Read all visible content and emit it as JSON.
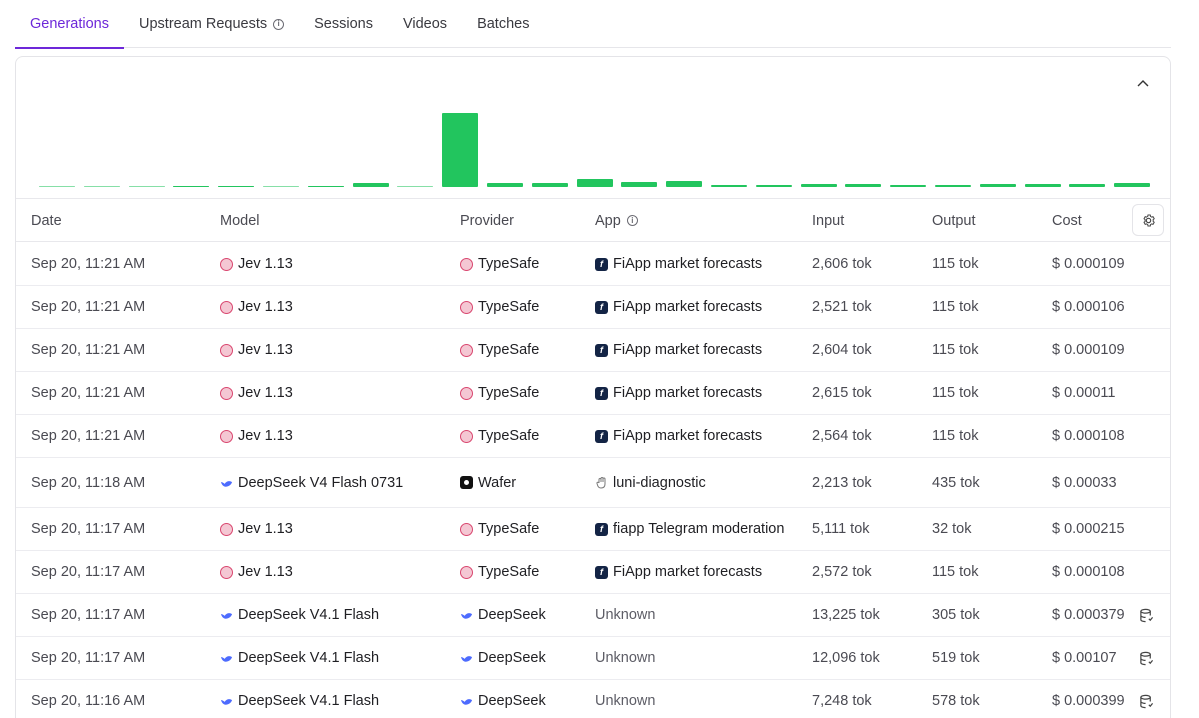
{
  "tabs": [
    {
      "label": "Generations",
      "active": true
    },
    {
      "label": "Upstream Requests",
      "info": true
    },
    {
      "label": "Sessions"
    },
    {
      "label": "Videos"
    },
    {
      "label": "Batches"
    }
  ],
  "chart_data": {
    "type": "bar",
    "color": "#22c55e",
    "values": [
      1,
      1,
      1,
      2,
      2,
      0,
      2,
      5,
      1,
      100,
      5,
      5,
      11,
      7,
      8,
      3,
      3,
      4,
      4,
      3,
      3,
      4,
      4,
      4,
      6
    ]
  },
  "table": {
    "headers": {
      "date": "Date",
      "model": "Model",
      "provider": "Provider",
      "app": "App",
      "input": "Input",
      "output": "Output",
      "cost": "Cost"
    },
    "rows": [
      {
        "date": "Sep 20, 11:21 AM",
        "model": "Jev 1.13",
        "model_icon": "typesafe-icon",
        "provider": "TypeSafe",
        "provider_icon": "typesafe-icon",
        "app": "FiApp market forecasts",
        "app_icon": "fiapp-icon",
        "input": "2,606 tok",
        "output": "115 tok",
        "cost": "$ 0.000109"
      },
      {
        "date": "Sep 20, 11:21 AM",
        "model": "Jev 1.13",
        "model_icon": "typesafe-icon",
        "provider": "TypeSafe",
        "provider_icon": "typesafe-icon",
        "app": "FiApp market forecasts",
        "app_icon": "fiapp-icon",
        "input": "2,521 tok",
        "output": "115 tok",
        "cost": "$ 0.000106"
      },
      {
        "date": "Sep 20, 11:21 AM",
        "model": "Jev 1.13",
        "model_icon": "typesafe-icon",
        "provider": "TypeSafe",
        "provider_icon": "typesafe-icon",
        "app": "FiApp market forecasts",
        "app_icon": "fiapp-icon",
        "input": "2,604 tok",
        "output": "115 tok",
        "cost": "$ 0.000109"
      },
      {
        "date": "Sep 20, 11:21 AM",
        "model": "Jev 1.13",
        "model_icon": "typesafe-icon",
        "provider": "TypeSafe",
        "provider_icon": "typesafe-icon",
        "app": "FiApp market forecasts",
        "app_icon": "fiapp-icon",
        "input": "2,615 tok",
        "output": "115 tok",
        "cost": "$ 0.00011"
      },
      {
        "date": "Sep 20, 11:21 AM",
        "model": "Jev 1.13",
        "model_icon": "typesafe-icon",
        "provider": "TypeSafe",
        "provider_icon": "typesafe-icon",
        "app": "FiApp market forecasts",
        "app_icon": "fiapp-icon",
        "input": "2,564 tok",
        "output": "115 tok",
        "cost": "$ 0.000108"
      },
      {
        "date": "Sep 20, 11:18 AM",
        "model": "DeepSeek V4 Flash 0731",
        "model_icon": "deepseek-icon",
        "provider": "Wafer",
        "provider_icon": "wafer-icon",
        "app": "luni-diagnostic",
        "app_icon": "hand-icon",
        "input": "2,213 tok",
        "output": "435 tok",
        "cost": "$ 0.00033"
      },
      {
        "date": "Sep 20, 11:17 AM",
        "model": "Jev 1.13",
        "model_icon": "typesafe-icon",
        "provider": "TypeSafe",
        "provider_icon": "typesafe-icon",
        "app": "fiapp Telegram moderation",
        "app_icon": "fiapp-icon",
        "input": "5,111 tok",
        "output": "32 tok",
        "cost": "$ 0.000215"
      },
      {
        "date": "Sep 20, 11:17 AM",
        "model": "Jev 1.13",
        "model_icon": "typesafe-icon",
        "provider": "TypeSafe",
        "provider_icon": "typesafe-icon",
        "app": "FiApp market forecasts",
        "app_icon": "fiapp-icon",
        "input": "2,572 tok",
        "output": "115 tok",
        "cost": "$ 0.000108"
      },
      {
        "date": "Sep 20, 11:17 AM",
        "model": "DeepSeek V4.1 Flash",
        "model_icon": "deepseek-icon",
        "provider": "DeepSeek",
        "provider_icon": "deepseek-icon",
        "app": "Unknown",
        "app_icon": "",
        "input": "13,225 tok",
        "output": "305 tok",
        "cost": "$ 0.000379",
        "db": true
      },
      {
        "date": "Sep 20, 11:17 AM",
        "model": "DeepSeek V4.1 Flash",
        "model_icon": "deepseek-icon",
        "provider": "DeepSeek",
        "provider_icon": "deepseek-icon",
        "app": "Unknown",
        "app_icon": "",
        "input": "12,096 tok",
        "output": "519 tok",
        "cost": "$ 0.00107",
        "db": true
      },
      {
        "date": "Sep 20, 11:16 AM",
        "model": "DeepSeek V4.1 Flash",
        "model_icon": "deepseek-icon",
        "provider": "DeepSeek",
        "provider_icon": "deepseek-icon",
        "app": "Unknown",
        "app_icon": "",
        "input": "7,248 tok",
        "output": "578 tok",
        "cost": "$ 0.000399",
        "db": true
      }
    ]
  }
}
